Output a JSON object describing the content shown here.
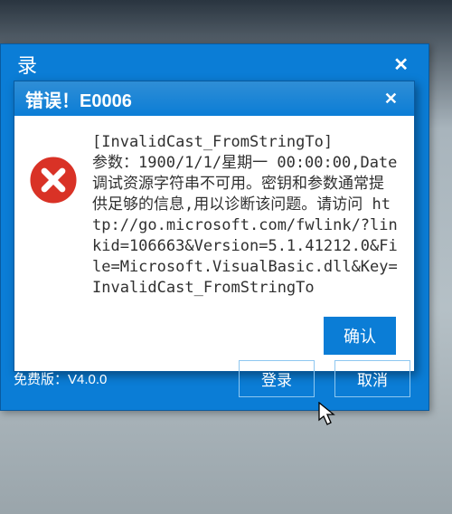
{
  "outer": {
    "title": "录",
    "close": "✕",
    "version_label": "免费版：V4.0.0",
    "buttons": {
      "login": "登录",
      "cancel": "取消"
    }
  },
  "dialog": {
    "title": "错误！E0006",
    "close": "✕",
    "message": "[InvalidCast_FromStringTo]\n参数：1900/1/1/星期一 00:00:00,Date\n调试资源字符串不可用。密钥和参数通常提供足够的信息,用以诊断该问题。请访问 http://go.microsoft.com/fwlink/?linkid=106663&Version=5.1.41212.0&File=Microsoft.VisualBasic.dll&Key=InvalidCast_FromStringTo",
    "ok": "确认"
  }
}
